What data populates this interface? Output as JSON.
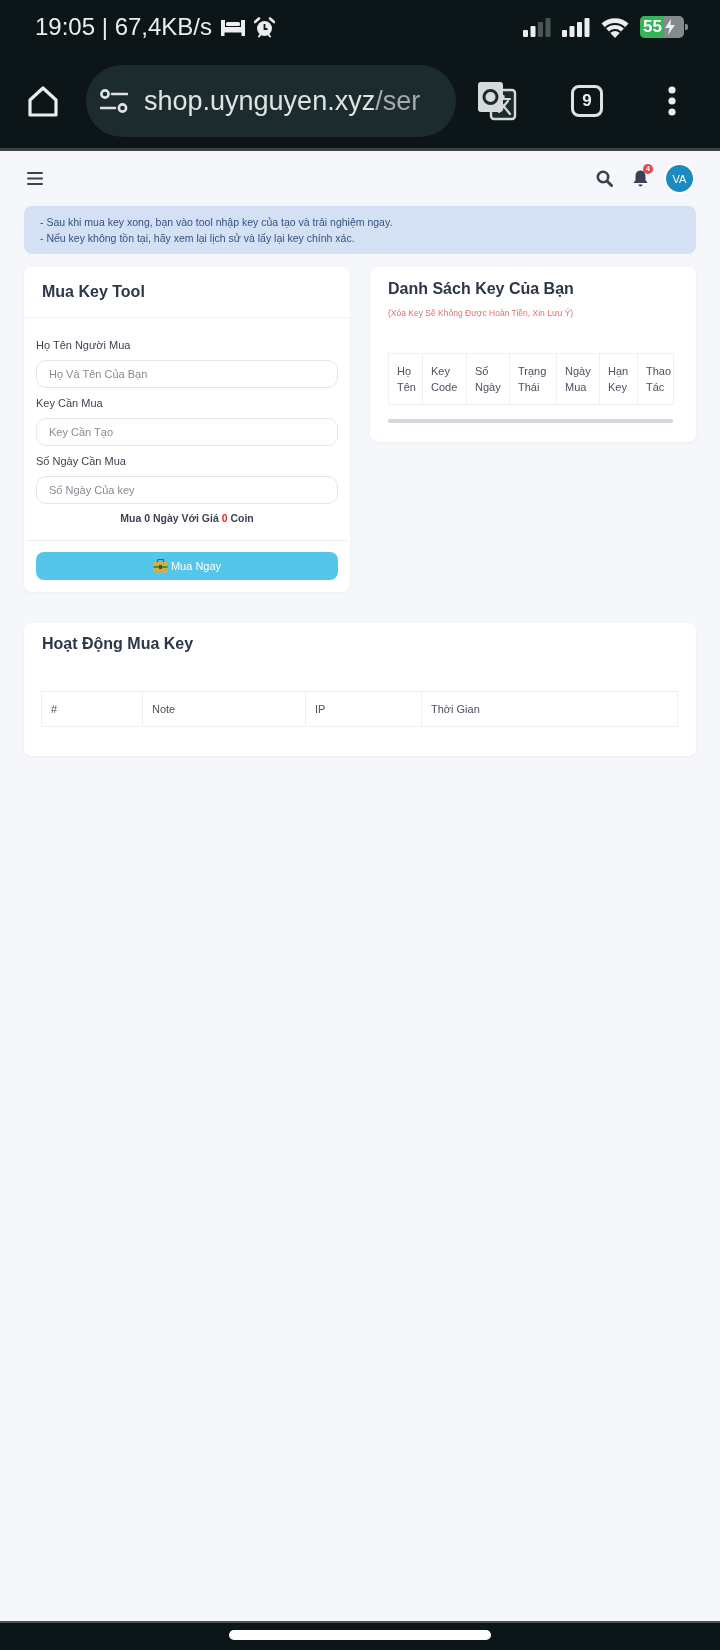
{
  "status_bar": {
    "time": "19:05 | 67,4KB/s",
    "battery": "55"
  },
  "browser_bar": {
    "url_host": "shop.uynguyen.xyz",
    "url_path": "/ser",
    "tab_count": "9"
  },
  "top_nav": {
    "notification_count": "4",
    "avatar": "VA"
  },
  "notice": {
    "lines": [
      "- Sau khi mua key xong, bạn vào tool nhập key của tạo và trải nghiệm ngay.",
      "- Nếu key không tồn tại, hãy xem lại lịch sử và lấy lại key chính xác."
    ]
  },
  "buy_form": {
    "title": "Mua Key Tool",
    "fields": [
      {
        "label": "Họ Tên Người Mua",
        "placeholder": "Họ Và Tên Của Bạn"
      },
      {
        "label": "Key Cần Mua",
        "placeholder": "Key Cần Tạo"
      },
      {
        "label": "Số Ngày Cần Mua",
        "placeholder": "Số Ngày Của key"
      }
    ],
    "summary": {
      "text_before": "Mua 0 Ngày Với Giá",
      "price": "0",
      "text_after": "Coin"
    },
    "submit_button": "Mua Ngay"
  },
  "key_list": {
    "title": "Danh Sách Key Của Bạn",
    "note": "(Xóa Key Sẽ Không Được Hoàn Tiền, Xin Lưu Ý)",
    "columns": [
      "Họ Tên",
      "Key Code",
      "Số Ngày",
      "Trạng Thái",
      "Ngày Mua",
      "Hạn Key",
      "Thao Tác"
    ]
  },
  "activity": {
    "title": "Hoạt Động Mua Key",
    "columns": [
      "#",
      "Note",
      "IP",
      "Thời Gian"
    ]
  }
}
